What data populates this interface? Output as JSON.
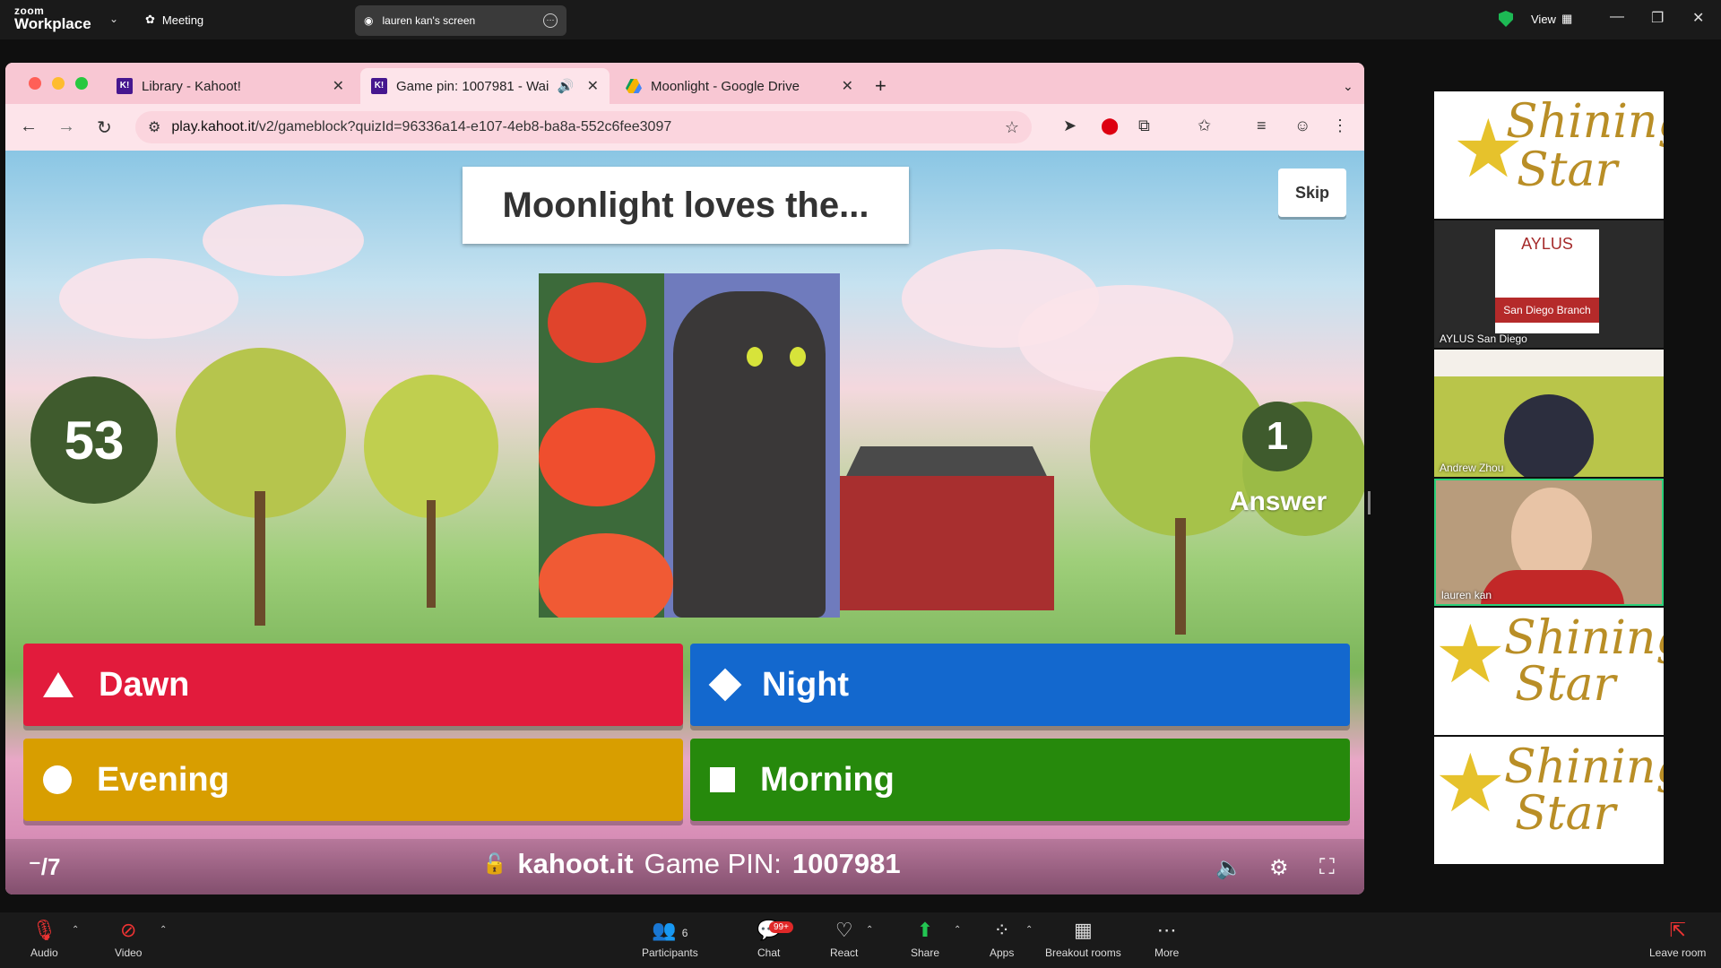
{
  "zoom": {
    "brand_top": "zoom",
    "brand_bottom": "Workplace",
    "meeting_label": "Meeting",
    "share_label": "lauren kan's screen",
    "view_label": "View"
  },
  "browser": {
    "tabs": [
      {
        "label": "Library - Kahoot!"
      },
      {
        "label": "Game pin: 1007981 - Wai"
      },
      {
        "label": "Moonlight - Google Drive"
      }
    ],
    "url_host": "play.kahoot.it",
    "url_path": "/v2/gameblock?quizId=96336a14-e107-4eb8-ba8a-552c6fee3097"
  },
  "game": {
    "question": "Moonlight loves the...",
    "skip_label": "Skip",
    "timer": "53",
    "answer_count": "1",
    "answer_label": "Answer",
    "answers": [
      {
        "label": "Dawn",
        "shape": "triangle",
        "color": "#e21b3c"
      },
      {
        "label": "Night",
        "shape": "diamond",
        "color": "#1368ce"
      },
      {
        "label": "Evening",
        "shape": "circle",
        "color": "#d89e00"
      },
      {
        "label": "Morning",
        "shape": "square",
        "color": "#26890c"
      }
    ],
    "counter": "⁻/7",
    "pin_site": "kahoot.it",
    "pin_label": "Game PIN:",
    "pin_value": "1007981"
  },
  "participants": {
    "aylus_logo": "AYLUS",
    "aylus_branch": "San Diego Branch",
    "aylus_name": "AYLUS San Diego",
    "andrew_name": "Andrew Zhou",
    "lauren_name": "lauren kan",
    "shining_1": "Shining",
    "shining_2": "Star"
  },
  "toolbar": {
    "audio": "Audio",
    "video": "Video",
    "participants": "Participants",
    "participants_count": "6",
    "chat": "Chat",
    "chat_badge": "99+",
    "react": "React",
    "share": "Share",
    "apps": "Apps",
    "breakout": "Breakout rooms",
    "more": "More",
    "leave": "Leave room"
  }
}
